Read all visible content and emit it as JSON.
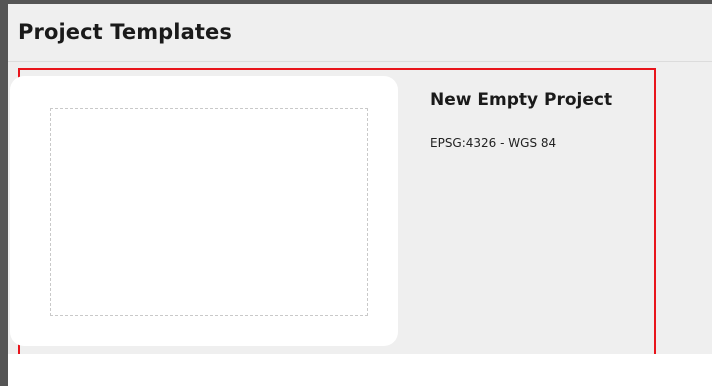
{
  "panel": {
    "title": "Project Templates"
  },
  "templates": [
    {
      "name": "New Empty Project",
      "crs": "EPSG:4326 - WGS 84",
      "selected": true,
      "selection_color": "#e8141b"
    }
  ]
}
